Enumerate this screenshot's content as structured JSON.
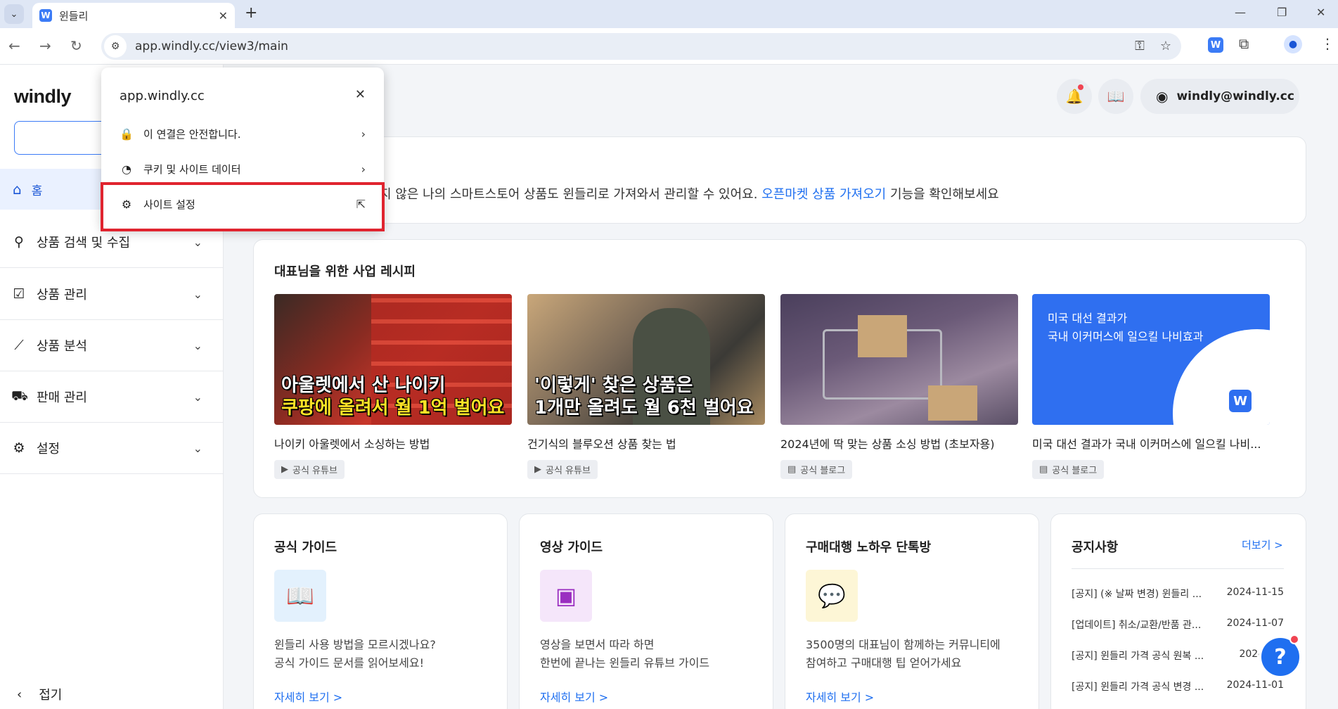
{
  "browser": {
    "tab_title": "윈들리",
    "tab_favicon": "W",
    "url": "app.windly.cc/view3/main",
    "menu_glyph": "⌄",
    "close_glyph": "✕",
    "new_tab_glyph": "+",
    "minimize_glyph": "—",
    "restore_glyph": "❐",
    "win_close_glyph": "✕",
    "back_glyph": "←",
    "forward_glyph": "→",
    "reload_glyph": "↻",
    "site_info_glyph": "⚙",
    "key_glyph": "⚿",
    "star_glyph": "☆",
    "ext_w": "W",
    "puzzle_glyph": "⧉",
    "profile_glyph": "●",
    "kebab_glyph": "⋮"
  },
  "sidebar": {
    "logo": "windly",
    "new_button": "+",
    "home": {
      "icon": "⌂",
      "label": "홈"
    },
    "items": [
      {
        "icon": "⚲",
        "label": "상품 검색 및 수집"
      },
      {
        "icon": "☑",
        "label": "상품 관리"
      },
      {
        "icon": "⟋",
        "label": "상품 분석"
      },
      {
        "icon": "⛟",
        "label": "판매 관리"
      },
      {
        "icon": "⚙",
        "label": "설정"
      }
    ],
    "chevron": "⌄",
    "collapse_icon": "‹",
    "collapse_label": "접기"
  },
  "header": {
    "bell_glyph": "🔔",
    "book_glyph": "📖",
    "account_glyph": "◉",
    "account": "windly@windly.cc"
  },
  "banner": {
    "text_before": "지 않은 나의 스마트스토어 상품도 윈들리로 가져와서 관리할 수 있어요. ",
    "link": "오픈마켓 상품 가져오기",
    "text_after": " 기능을 확인해보세요"
  },
  "recipes": {
    "title": "대표님을 위한 사업 레시피",
    "items": [
      {
        "cap1": "아울렛에서 산 나이키",
        "cap2": "쿠팡에 올려서 월 1억 벌어요",
        "title": "나이키 아울렛에서 소싱하는 방법",
        "tag": "공식 유튜브",
        "tag_icon": "▶"
      },
      {
        "cap1": "'이렇게' 찾은 상품은",
        "cap2": "1개만 올려도 월 6천 벌어요",
        "title": "건기식의 블루오션 상품 찾는 법",
        "tag": "공식 유튜브",
        "tag_icon": "▶"
      },
      {
        "title": "2024년에 딱 맞는 상품 소싱 방법 (초보자용)",
        "tag": "공식 블로그",
        "tag_icon": "▤"
      },
      {
        "cap1": "미국 대선 결과가",
        "cap2": "국내 이커머스에 일으킬 나비효과",
        "badge": "W",
        "title": "미국 대선 결과가 국내 이커머스에 일으킬 나비...",
        "tag": "공식 블로그",
        "tag_icon": "▤"
      }
    ]
  },
  "guides": [
    {
      "title": "공식 가이드",
      "icon": "📖",
      "desc1": "윈들리 사용 방법을 모르시겠나요?",
      "desc2": "공식 가이드 문서를 읽어보세요!",
      "link": "자세히 보기 >"
    },
    {
      "title": "영상 가이드",
      "icon": "▣",
      "desc1": "영상을 보면서 따라 하면",
      "desc2": "한번에 끝나는 윈들리 유튜브 가이드",
      "link": "자세히 보기 >"
    },
    {
      "title": "구매대행 노하우 단톡방",
      "icon": "💬",
      "desc1": "3500명의 대표님이 함께하는 커뮤니티에",
      "desc2": "참여하고 구매대행 팁 얻어가세요",
      "link": "자세히 보기 >"
    }
  ],
  "notices": {
    "title": "공지사항",
    "more": "더보기 >",
    "rows": [
      {
        "title": "[공지] (※ 날짜 변경) 윈들리 ...",
        "date": "2024-11-15"
      },
      {
        "title": "[업데이트] 취소/교환/반품 관...",
        "date": "2024-11-07"
      },
      {
        "title": "[공지] 윈들리 가격 공식 원복 ...",
        "date": "2024-11-"
      },
      {
        "title": "[공지] 윈들리 가격 공식 변경 ...",
        "date": "2024-11-01"
      }
    ]
  },
  "help_glyph": "?",
  "popup": {
    "domain": "app.windly.cc",
    "close_glyph": "✕",
    "rows": [
      {
        "icon": "🔒",
        "label": "이 연결은 안전합니다.",
        "tail": "›"
      },
      {
        "icon": "◔",
        "label": "쿠키 및 사이트 데이터",
        "tail": "›"
      },
      {
        "icon": "⚙",
        "label": "사이트 설정",
        "tail": "⇱"
      }
    ]
  },
  "colors": {
    "accent": "#1f6ff0",
    "highlight": "#e0242f",
    "brand": "#3b7bf6"
  }
}
